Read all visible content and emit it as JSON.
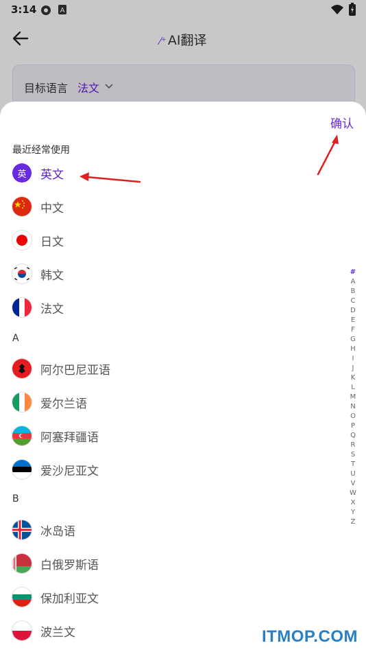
{
  "status": {
    "time": "3:14"
  },
  "header": {
    "title": "AI翻译"
  },
  "target": {
    "label": "目标语言",
    "value": "法文"
  },
  "sheet": {
    "confirm": "确认",
    "recent_title": "最近经常使用",
    "recent": [
      "英文",
      "中文",
      "日文",
      "韩文",
      "法文"
    ],
    "selected_badge": "英",
    "section_a": "A",
    "a_items": [
      "阿尔巴尼亚语",
      "爱尔兰语",
      "阿塞拜疆语",
      "爱沙尼亚文"
    ],
    "section_b": "B",
    "b_items": [
      "冰岛语",
      "白俄罗斯语",
      "保加利亚文",
      "波兰文"
    ]
  },
  "index": [
    "#",
    "A",
    "B",
    "C",
    "D",
    "E",
    "F",
    "G",
    "H",
    "I",
    "J",
    "K",
    "L",
    "M",
    "N",
    "O",
    "P",
    "Q",
    "R",
    "S",
    "T",
    "U",
    "V",
    "W",
    "X",
    "Y",
    "Z"
  ],
  "watermark": "ITMOP.COM",
  "colors": {
    "accent": "#6a2be0",
    "arrow": "#e02020"
  }
}
